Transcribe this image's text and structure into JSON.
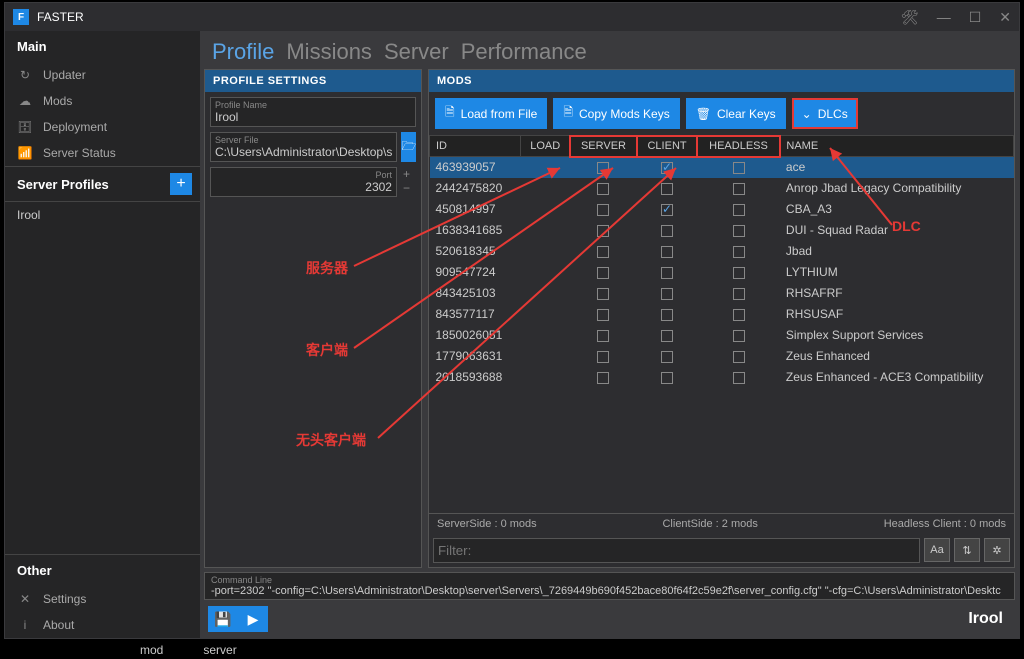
{
  "app": {
    "title": "FASTER"
  },
  "sidebar": {
    "main_label": "Main",
    "items": [
      {
        "icon": "↻",
        "label": "Updater"
      },
      {
        "icon": "☁",
        "label": "Mods"
      },
      {
        "icon": "🗄",
        "label": "Deployment"
      },
      {
        "icon": "📶",
        "label": "Server Status"
      }
    ],
    "profiles_label": "Server Profiles",
    "profiles": [
      "Irool"
    ],
    "other_label": "Other",
    "other_items": [
      {
        "icon": "✕",
        "label": "Settings"
      },
      {
        "icon": "i",
        "label": "About"
      }
    ]
  },
  "tabs": [
    "Profile",
    "Missions",
    "Server",
    "Performance"
  ],
  "profile_settings": {
    "header": "PROFILE SETTINGS",
    "name_label": "Profile Name",
    "name_value": "Irool",
    "file_label": "Server File",
    "file_value": "C:\\Users\\Administrator\\Desktop\\s",
    "port_label": "Port",
    "port_value": "2302"
  },
  "mods_panel": {
    "header": "MODS",
    "buttons": {
      "load": "Load from File",
      "copy": "Copy Mods Keys",
      "clear": "Clear Keys",
      "dlcs": "DLCs"
    },
    "columns": {
      "id": "ID",
      "load": "LOAD",
      "server": "SERVER",
      "client": "CLIENT",
      "headless": "HEADLESS",
      "name": "NAME"
    },
    "rows": [
      {
        "id": "463939057",
        "server": false,
        "client": true,
        "headless": false,
        "name": "ace",
        "selected": true
      },
      {
        "id": "2442475820",
        "server": false,
        "client": false,
        "headless": false,
        "name": "Anrop Jbad Legacy Compatibility"
      },
      {
        "id": "450814997",
        "server": false,
        "client": true,
        "headless": false,
        "name": "CBA_A3"
      },
      {
        "id": "1638341685",
        "server": false,
        "client": false,
        "headless": false,
        "name": "DUI - Squad Radar"
      },
      {
        "id": "520618345",
        "server": false,
        "client": false,
        "headless": false,
        "name": "Jbad"
      },
      {
        "id": "909547724",
        "server": false,
        "client": false,
        "headless": false,
        "name": "LYTHIUM"
      },
      {
        "id": "843425103",
        "server": false,
        "client": false,
        "headless": false,
        "name": "RHSAFRF"
      },
      {
        "id": "843577117",
        "server": false,
        "client": false,
        "headless": false,
        "name": "RHSUSAF"
      },
      {
        "id": "1850026051",
        "server": false,
        "client": false,
        "headless": false,
        "name": "Simplex Support Services"
      },
      {
        "id": "1779063631",
        "server": false,
        "client": false,
        "headless": false,
        "name": "Zeus Enhanced"
      },
      {
        "id": "2018593688",
        "server": false,
        "client": false,
        "headless": false,
        "name": "Zeus Enhanced - ACE3 Compatibility"
      }
    ],
    "stats": {
      "server": "ServerSide : 0 mods",
      "client": "ClientSide : 2 mods",
      "headless": "Headless Client : 0 mods"
    },
    "filter_placeholder": "Filter:"
  },
  "cmdline": {
    "label": "Command Line",
    "value": "-port=2302 \"-config=C:\\Users\\Administrator\\Desktop\\server\\Servers\\_7269449b690f452bace80f64f2c59e2f\\server_config.cfg\" \"-cfg=C:\\Users\\Administrator\\Desktc"
  },
  "bottom": {
    "profile": "Irool"
  },
  "statusbar": {
    "mod": "mod",
    "server": "server"
  },
  "annotations": {
    "server_zh": "服务器",
    "client_zh": "客户端",
    "headless_zh": "无头客户端",
    "dlc": "DLC"
  }
}
